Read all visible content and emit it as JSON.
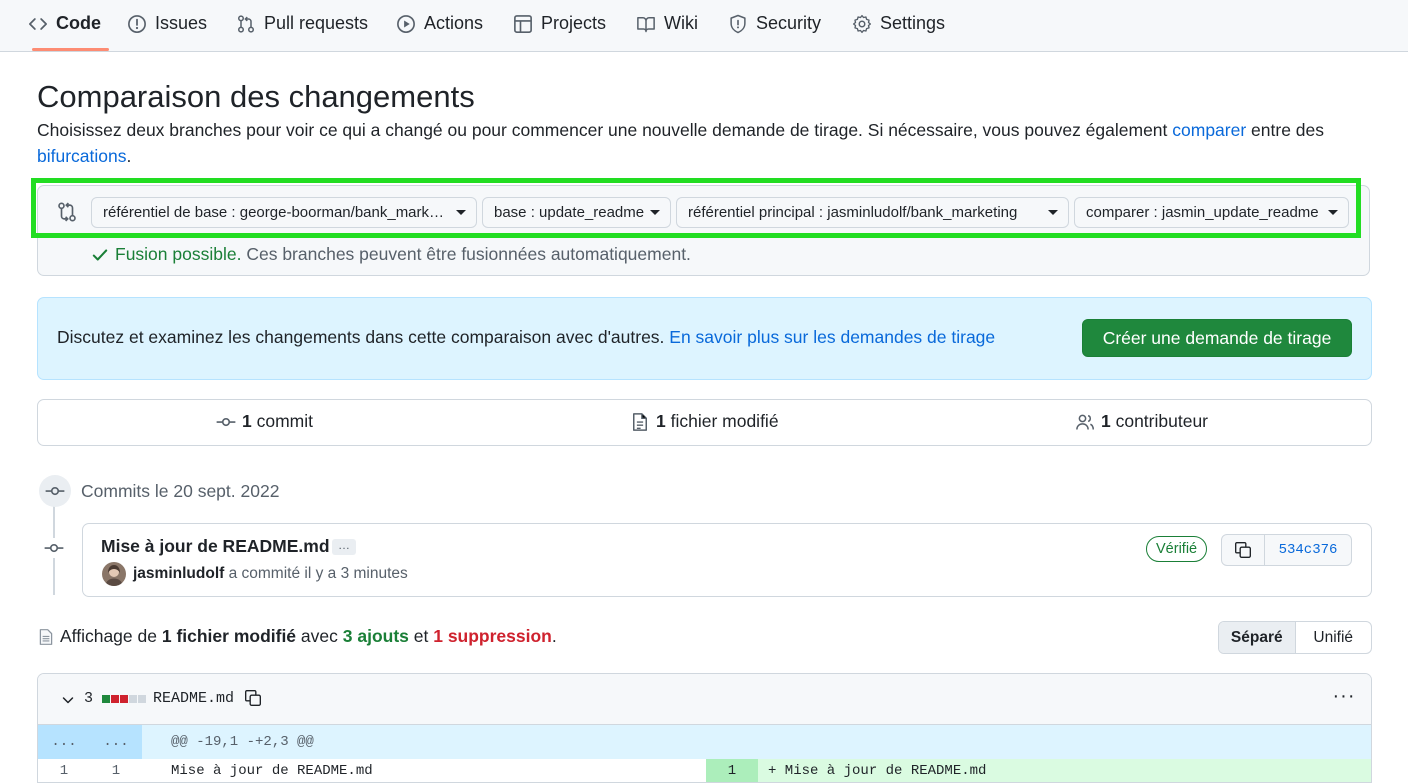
{
  "nav": {
    "tabs": [
      {
        "label": "Code",
        "icon": "code-icon"
      },
      {
        "label": "Issues",
        "icon": "issue-opened-icon"
      },
      {
        "label": "Pull requests",
        "icon": "git-pull-request-icon"
      },
      {
        "label": "Actions",
        "icon": "play-icon"
      },
      {
        "label": "Projects",
        "icon": "table-icon"
      },
      {
        "label": "Wiki",
        "icon": "book-icon"
      },
      {
        "label": "Security",
        "icon": "shield-icon"
      },
      {
        "label": "Settings",
        "icon": "gear-icon"
      }
    ],
    "selected": "Code"
  },
  "header": {
    "title": "Comparaison des changements",
    "desc_before": "Choisissez deux branches pour voir ce qui a changé ou pour commencer une nouvelle demande de tirage. Si nécessaire, vous pouvez également ",
    "desc_link1": "comparer",
    "desc_middle": " entre des ",
    "desc_link2": "bifurcations",
    "desc_after": "."
  },
  "range": {
    "base_repo": "référentiel de base : george-boorman/bank_marketing",
    "base_branch": "base : update_readme",
    "head_repo": "référentiel principal : jasminludolf/bank_marketing",
    "compare_branch": "comparer : jasmin_update_readme",
    "merge_ok": "Fusion possible.",
    "merge_msg": " Ces branches peuvent être fusionnées automatiquement."
  },
  "blankslate": {
    "text": "Discutez et examinez les changements dans cette comparaison avec d'autres. ",
    "link": "En savoir plus sur les demandes de tirage",
    "button": "Créer une demande de tirage"
  },
  "summary": {
    "commits_count": "1",
    "commits_label": " commit",
    "files_count": "1",
    "files_label": " fichier modifié",
    "contributors_count": "1",
    "contributors_label": " contributeur"
  },
  "commits": {
    "date_label": "Commits le 20 sept. 2022",
    "items": [
      {
        "title": "Mise à jour de README.md",
        "ellipsis": "…",
        "author": "jasminludolf",
        "meta": " a commité il y a 3 minutes",
        "verified": "Vérifié",
        "sha": "534c376"
      }
    ]
  },
  "toc": {
    "p1": "Affichage de ",
    "files": "1 fichier modifié",
    "p2": " avec ",
    "additions": "3 ajouts",
    "p3": " et ",
    "deletions": "1 suppression",
    "p4": ".",
    "split": "Séparé",
    "unified": "Unifié"
  },
  "file": {
    "changes": "3",
    "name": "README.md",
    "menu": "···",
    "hunk_left": "...",
    "hunk_right": "...",
    "hunk_header": "@@ -19,1 -+2,3 @@",
    "line_left_num_a": "1",
    "line_left_num_b": "1",
    "line_left_text": "Mise à jour de README.md",
    "line_right_num": "1",
    "line_right_text": "+ Mise à jour de README.md"
  },
  "colors": {
    "accent": "#0969da",
    "success": "#1a7f37",
    "danger": "#cf222e",
    "primary_button": "#1f883d",
    "highlight": "#22dd22"
  }
}
